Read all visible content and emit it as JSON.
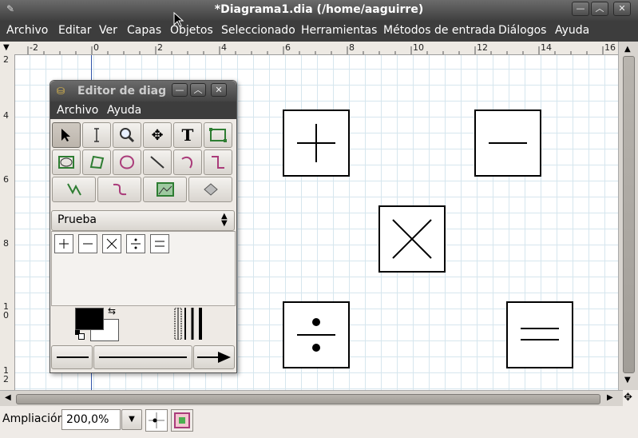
{
  "window": {
    "title": "*Diagrama1.dia (/home/aaguirre)",
    "controls": [
      "minimize",
      "maximize",
      "close"
    ]
  },
  "menubar": {
    "items": [
      {
        "label": "Archivo"
      },
      {
        "label": "Editar"
      },
      {
        "label": "Ver"
      },
      {
        "label": "Capas"
      },
      {
        "label": "Objetos"
      },
      {
        "label": "Seleccionado"
      },
      {
        "label": "Herramientas"
      },
      {
        "label": "Métodos de entrada"
      },
      {
        "label": "Diálogos"
      },
      {
        "label": "Ayuda"
      }
    ]
  },
  "rulers": {
    "horizontal": [
      "-2",
      "0",
      "2",
      "4",
      "6",
      "8",
      "10",
      "12",
      "14",
      "16"
    ],
    "vertical": [
      "2",
      "4",
      "6",
      "8",
      "10",
      "12"
    ]
  },
  "canvas": {
    "shapes": [
      {
        "type": "plus",
        "icon": "plus-icon"
      },
      {
        "type": "minus",
        "icon": "minus-icon"
      },
      {
        "type": "multiply",
        "icon": "multiply-icon"
      },
      {
        "type": "divide",
        "icon": "divide-icon"
      },
      {
        "type": "equals",
        "icon": "equals-icon"
      }
    ]
  },
  "toolbox": {
    "title": "Editor de diag",
    "menu": [
      {
        "label": "Archivo"
      },
      {
        "label": "Ayuda"
      }
    ],
    "sheet_selector": "Prueba",
    "tools_row1": [
      "select-icon",
      "text-cursor-icon",
      "zoom-icon",
      "move-icon",
      "text-icon",
      "box-icon"
    ],
    "tools_row2": [
      "ellipse-icon",
      "polygon-icon",
      "beziergon-icon",
      "line-icon",
      "arc-icon",
      "zigzag-icon"
    ],
    "tools_row3": [
      "polyline-icon",
      "bezier-icon",
      "image-icon",
      "outline-icon"
    ],
    "sheet_shapes": [
      "plus-icon",
      "minus-icon",
      "multiply-icon",
      "divide-icon",
      "equals-icon"
    ],
    "colors": {
      "foreground": "#000000",
      "background": "#ffffff"
    }
  },
  "statusbar": {
    "zoom_label": "Ampliación",
    "zoom_value": "200,0%"
  }
}
